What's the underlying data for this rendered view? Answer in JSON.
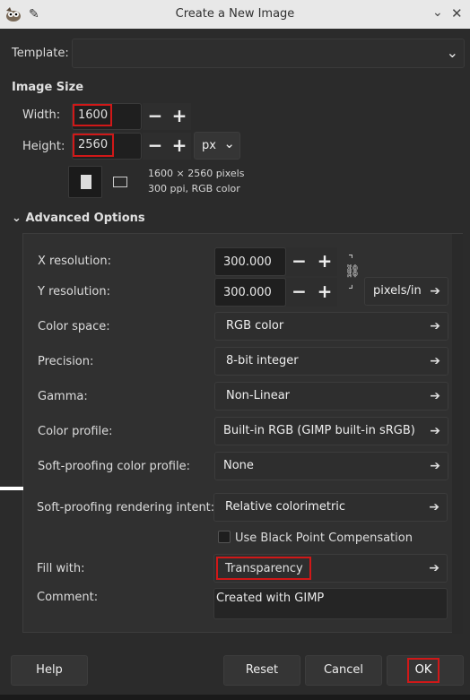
{
  "window": {
    "title": "Create a New Image"
  },
  "template": {
    "label": "Template:",
    "value": ""
  },
  "image_size": {
    "heading": "Image Size",
    "width_label": "Width:",
    "width_value": "1600",
    "height_label": "Height:",
    "height_value": "2560",
    "unit": "px",
    "info_line1": "1600 × 2560 pixels",
    "info_line2": "300 ppi, RGB color"
  },
  "advanced": {
    "heading": "Advanced Options",
    "x_res_label": "X resolution:",
    "x_res_value": "300.000",
    "y_res_label": "Y resolution:",
    "y_res_value": "300.000",
    "res_unit": "pixels/in",
    "color_space_label": "Color space:",
    "color_space_value": "RGB color",
    "precision_label": "Precision:",
    "precision_value": "8-bit integer",
    "gamma_label": "Gamma:",
    "gamma_value": "Non-Linear",
    "color_profile_label": "Color profile:",
    "color_profile_value": "Built-in RGB (GIMP built-in sRGB)",
    "softproof_label": "Soft-proofing color profile:",
    "softproof_value": "None",
    "intent_label": "Soft-proofing rendering intent:",
    "intent_value": "Relative colorimetric",
    "bpc_label": "Use Black Point Compensation",
    "fill_label": "Fill with:",
    "fill_value": "Transparency",
    "comment_label": "Comment:",
    "comment_value": "Created with GIMP"
  },
  "buttons": {
    "help": "Help",
    "reset": "Reset",
    "cancel": "Cancel",
    "ok": "OK"
  },
  "colors": {
    "dialog_bg": "#2b2b2b",
    "titlebar_bg": "#e8e8e8",
    "highlight_red": "#d01818"
  }
}
